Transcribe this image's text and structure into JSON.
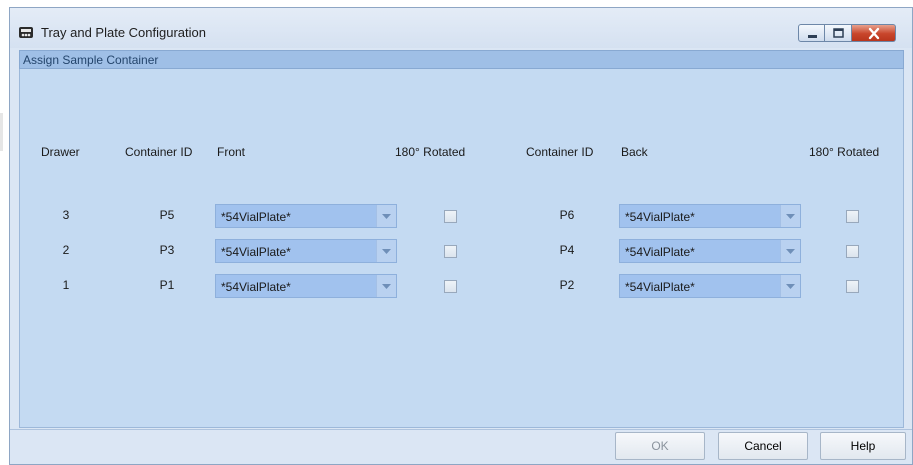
{
  "window": {
    "title": "Tray and Plate Configuration"
  },
  "group": {
    "header": "Assign Sample Container"
  },
  "columns": {
    "drawer": "Drawer",
    "front_id": "Container ID",
    "front": "Front",
    "front_rotated": "180° Rotated",
    "back_id": "Container ID",
    "back": "Back",
    "back_rotated": "180° Rotated"
  },
  "rows": [
    {
      "drawer": "3",
      "front_id": "P5",
      "front_value": "*54VialPlate*",
      "front_rotated": false,
      "back_id": "P6",
      "back_value": "*54VialPlate*",
      "back_rotated": false
    },
    {
      "drawer": "2",
      "front_id": "P3",
      "front_value": "*54VialPlate*",
      "front_rotated": false,
      "back_id": "P4",
      "back_value": "*54VialPlate*",
      "back_rotated": false
    },
    {
      "drawer": "1",
      "front_id": "P1",
      "front_value": "*54VialPlate*",
      "front_rotated": false,
      "back_id": "P2",
      "back_value": "*54VialPlate*",
      "back_rotated": false
    }
  ],
  "buttons": {
    "ok": "OK",
    "cancel": "Cancel",
    "help": "Help"
  },
  "icons": {
    "window": "tray-plate-icon",
    "minimize": "minimize-icon",
    "maximize": "maximize-icon",
    "close": "close-icon",
    "dropdown": "chevron-down-icon"
  },
  "colors": {
    "panel": "#c4daf2",
    "group_header": "#9fbfe6",
    "combo": "#a1c2ee",
    "close_button": "#c8452b"
  }
}
